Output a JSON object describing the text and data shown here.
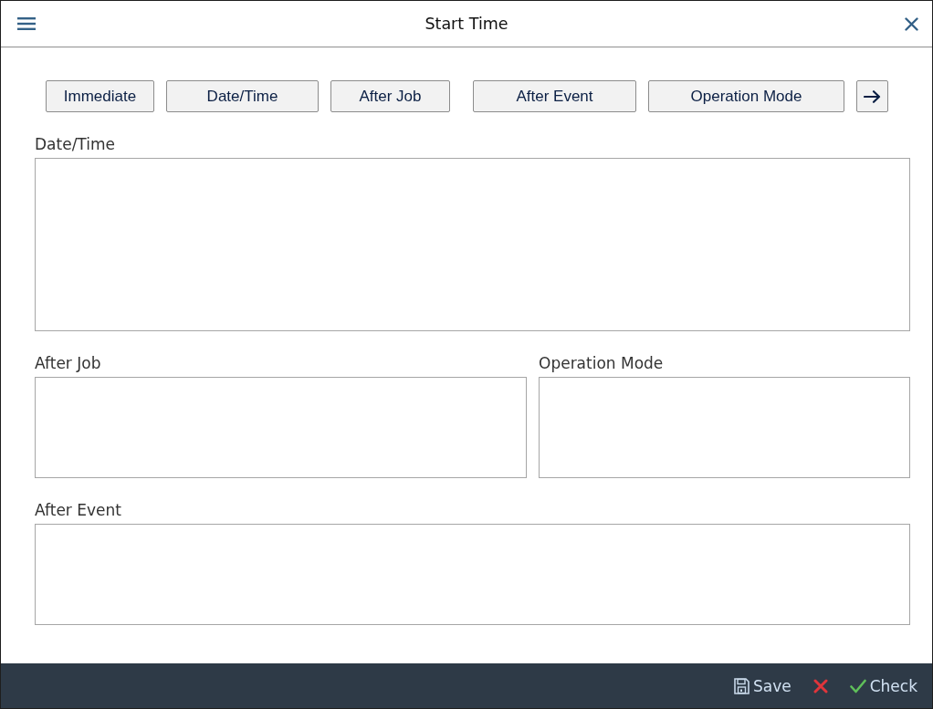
{
  "window": {
    "title": "Start Time"
  },
  "toolbar": {
    "buttons": [
      "Immediate",
      "Date/Time",
      "After Job",
      "After Event",
      "Operation Mode"
    ]
  },
  "groups": [
    {
      "title": "Date/Time"
    },
    {
      "title": "After Job"
    },
    {
      "title": "Operation Mode"
    },
    {
      "title": "After Event"
    }
  ],
  "footer": {
    "buttons": [
      {
        "kind": "save",
        "label": "Save"
      },
      {
        "kind": "cancel"
      },
      {
        "kind": "check",
        "label": "Check"
      }
    ]
  }
}
